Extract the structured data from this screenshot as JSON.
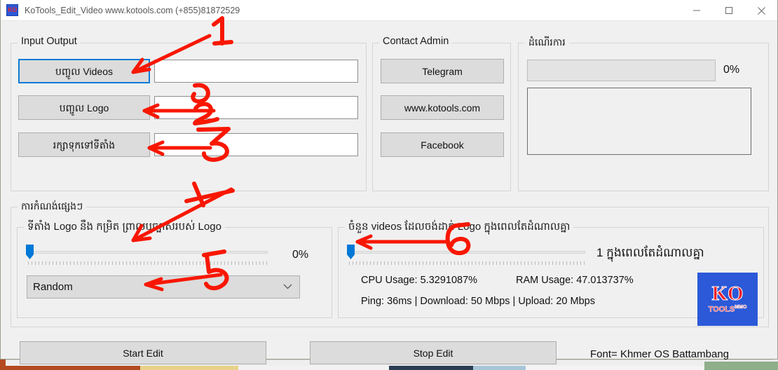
{
  "window": {
    "title": "KoTools_Edit_Video www.kotools.com (+855)81872529",
    "icon_text": "KO",
    "controls": {
      "minimize": "minimize-icon",
      "maximize": "maximize-icon",
      "close": "close-icon"
    }
  },
  "input_output": {
    "group_label": "Input Output",
    "rows": [
      {
        "button": "បញ្ចូល Videos",
        "value": "",
        "focused": true
      },
      {
        "button": "បញ្ចូល Logo",
        "value": "",
        "focused": false
      },
      {
        "button": "រក្សាទុកទៅទីតាំង",
        "value": "",
        "focused": false
      }
    ]
  },
  "contact_admin": {
    "group_label": "Contact Admin",
    "buttons": [
      "Telegram",
      "www.kotools.com",
      "Facebook"
    ]
  },
  "progress": {
    "group_label": "ដំណើរការ",
    "percent_label": "0%",
    "percent_value": 0,
    "log_text": ""
  },
  "settings": {
    "group_label": "ការកំណង់ផ្សេងៗ",
    "logo_position": {
      "group_label": "ទីតាំង Logo នឹង កម្រិត ព្រាល​ឬច្បាស់របស់ Logo",
      "slider_value": 0,
      "slider_label": "0%",
      "combo_value": "Random",
      "combo_chevron": "chevron-down-icon"
    },
    "concurrency": {
      "group_label": "ចំនួន videos ដែលចង់ដាក់ Logo ក្នុងពេលតែដំណាលគ្នា",
      "slider_value": 1,
      "slider_label": "1 ក្នុងពេលតែដំណាលគ្នា",
      "cpu_usage": "CPU Usage: 5.3291087%",
      "ram_usage": "RAM Usage: 47.013737%",
      "network": "Ping: 36ms | Download: 50 Mbps | Upload: 20 Mbps",
      "logo": {
        "primary": "KO",
        "secondary": "TOOLS",
        "superscript": "MMO"
      }
    }
  },
  "footer": {
    "start_button": "Start Edit",
    "stop_button": "Stop Edit",
    "font_note": "Font= Khmer OS Battambang"
  },
  "annotations": {
    "marks": [
      "1",
      "2",
      "3",
      "4",
      "5",
      "6"
    ],
    "color": "#f81700"
  },
  "colors": {
    "accent": "#0078d7",
    "focus_border": "#0a7bd4",
    "annotation": "#f81700",
    "logo_blue": "#2b59d8",
    "logo_red": "#ee1c25",
    "window_bg": "#f0f0f0"
  }
}
